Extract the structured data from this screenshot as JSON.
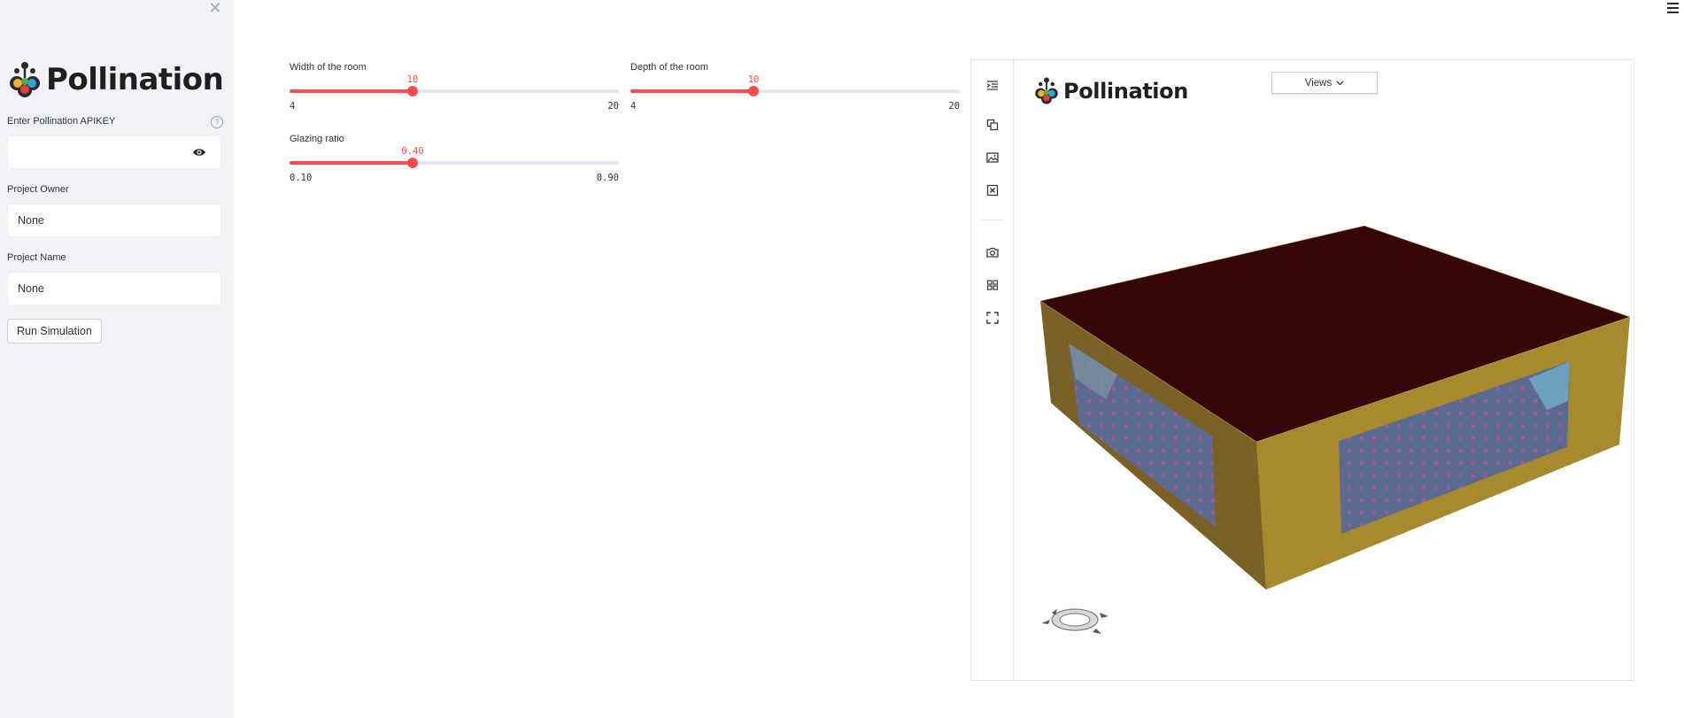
{
  "sidebar": {
    "close_icon": "close-icon",
    "logo_text": "Pollination",
    "apikey": {
      "label": "Enter Pollination APIKEY",
      "value": "",
      "help_icon": "question-icon",
      "toggle_icon": "eye-icon"
    },
    "owner": {
      "label": "Project Owner",
      "value": "None"
    },
    "project": {
      "label": "Project Name",
      "value": "None"
    },
    "run_button": "Run Simulation"
  },
  "menu_icon": "hamburger-icon",
  "sliders": {
    "width": {
      "label": "Width of the room",
      "value": "10",
      "min": "4",
      "max": "20",
      "fraction": 0.375
    },
    "depth": {
      "label": "Depth of the room",
      "value": "10",
      "min": "4",
      "max": "20",
      "fraction": 0.375
    },
    "glazing": {
      "label": "Glazing ratio",
      "value": "0.40",
      "min": "0.10",
      "max": "0.90",
      "fraction": 0.375
    }
  },
  "viewer": {
    "logo_text": "Pollination",
    "views_button": "Views",
    "toolbar_icons": [
      "indent-icon",
      "layers-icon",
      "image-icon",
      "close-box-icon",
      "camera-icon",
      "grid-icon",
      "fullscreen-icon"
    ],
    "colors": {
      "roof": "#350608",
      "wall_light": "#a88a2e",
      "wall_dark": "#7a6125",
      "glass": "#5a6b8f",
      "accent": "#ff4b4b"
    }
  }
}
